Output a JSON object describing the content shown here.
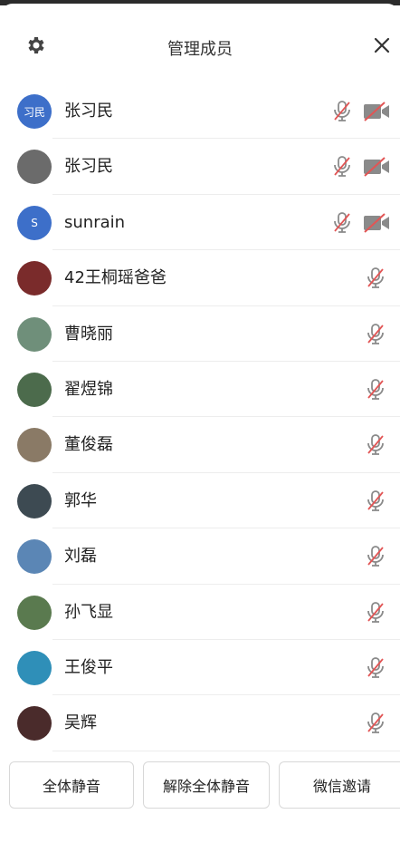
{
  "header": {
    "title": "管理成员"
  },
  "members": [
    {
      "name": "张习民",
      "avatar": {
        "text": "习民",
        "bg": "#3d6fc9"
      },
      "has_camera": true
    },
    {
      "name": "张习民",
      "avatar": {
        "text": "",
        "bg": "#6b6b6b"
      },
      "has_camera": true
    },
    {
      "name": "sunrain",
      "avatar": {
        "text": "S",
        "bg": "#3d6fc9"
      },
      "has_camera": true
    },
    {
      "name": "42王桐瑶爸爸",
      "avatar": {
        "text": "",
        "bg": "#7a2b2b"
      },
      "has_camera": false
    },
    {
      "name": "曹晓丽",
      "avatar": {
        "text": "",
        "bg": "#6f8f7a"
      },
      "has_camera": false
    },
    {
      "name": "翟煜锦",
      "avatar": {
        "text": "",
        "bg": "#4c6b4c"
      },
      "has_camera": false
    },
    {
      "name": "董俊磊",
      "avatar": {
        "text": "",
        "bg": "#8a7a66"
      },
      "has_camera": false
    },
    {
      "name": "郭华",
      "avatar": {
        "text": "",
        "bg": "#3d4a52"
      },
      "has_camera": false
    },
    {
      "name": "刘磊",
      "avatar": {
        "text": "",
        "bg": "#5b86b5"
      },
      "has_camera": false
    },
    {
      "name": "孙飞显",
      "avatar": {
        "text": "",
        "bg": "#5a7a4f"
      },
      "has_camera": false
    },
    {
      "name": "王俊平",
      "avatar": {
        "text": "",
        "bg": "#2f8fb8"
      },
      "has_camera": false
    },
    {
      "name": "吴辉",
      "avatar": {
        "text": "",
        "bg": "#4a2b2b"
      },
      "has_camera": false
    }
  ],
  "buttons": {
    "mute_all": "全体静音",
    "unmute_all": "解除全体静音",
    "wechat_invite": "微信邀请"
  },
  "colors": {
    "icon_gray": "#8a8a8a",
    "slash_red": "#e25555"
  }
}
